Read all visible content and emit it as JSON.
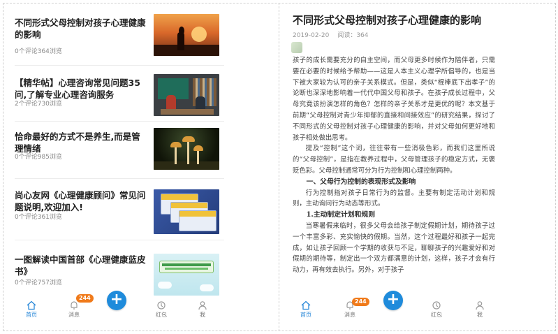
{
  "feed": {
    "items": [
      {
        "title": "不同形式父母控制对孩子心理健康的影响",
        "comments": "0个评论",
        "views": "364浏览",
        "thumb": "sunset-family-image"
      },
      {
        "title": "【精华帖】心理咨询常见问题35问,了解专业心理咨询服务",
        "comments": "2个评论",
        "views": "730浏览",
        "thumb": "counseling-studio-image"
      },
      {
        "title": "恰命最好的方式不是养生,而是管理情绪",
        "comments": "0个评论",
        "views": "985浏览",
        "thumb": "mushroom-image"
      },
      {
        "title": "尚心友网《心理健康顾问》常见问题说明,欢迎加入!",
        "comments": "0个评论",
        "views": "361浏览",
        "thumb": "member-cards-image"
      },
      {
        "title": "一图解读中国首部《心理健康蓝皮书》",
        "comments": "0个评论",
        "views": "757浏览",
        "thumb": "bluebook-banner-image"
      }
    ]
  },
  "tabbar": {
    "home": "首页",
    "messages": "消息",
    "badge": "244",
    "fab": "+",
    "redpacket": "红包",
    "me": "我"
  },
  "article": {
    "title": "不同形式父母控制对孩子心理健康的影响",
    "date": "2019-02-20",
    "reads": "阅读：364",
    "paragraphs": [
      {
        "kind": "plain",
        "text": "孩子的成长需要充分的自主空间，而父母更多时候作为陪伴者，只需要在必要的时候给予帮助——这是人本主义心理学所倡导的，也是当下被大家较为认可的亲子关系模式。但是，类似“棍棒底下出孝子”的论断也深深地影响着一代代中国父母和孩子。在孩子成长过程中，父母究竟该扮演怎样的角色？怎样的亲子关系才是更优的呢？本文基于前期“父母控制对青少年抑郁的直接和间接效应”的研究结果，探讨了不同形式的父母控制对孩子心理健康的影响，并对父母如何更好地和孩子相处做出思考。"
      },
      {
        "kind": "indent",
        "text": "提及“控制”这个词，往往带有一些消极色彩，而我们这里所说的“父母控制”，是指在教养过程中，父母管理孩子的稳定方式，无褒贬色彩。父母控制通常可分为行为控制和心理控制两种。"
      },
      {
        "kind": "h1",
        "text": "一、父母行为控制的表现形式及影响"
      },
      {
        "kind": "indent",
        "text": "行为控制指对孩子日常行为的监督。主要有制定活动计划和规则，主动询问行为动态等形式。"
      },
      {
        "kind": "h2",
        "text": "1.主动制定计划和规则"
      },
      {
        "kind": "indent",
        "text": "当寒暑假来临时，很多父母会给孩子制定假期计划，期待孩子过一个丰富多彩、充实愉快的假期。当然，这个过程最好和孩子一起完成，如让孩子回顾一个学期的收获与不足，聊聊孩子的兴趣爱好和对假期的期待等，制定出一个双方都满意的计划，这样，孩子才会有行动力，再有效去执行。另外，对于孩子"
      }
    ]
  }
}
